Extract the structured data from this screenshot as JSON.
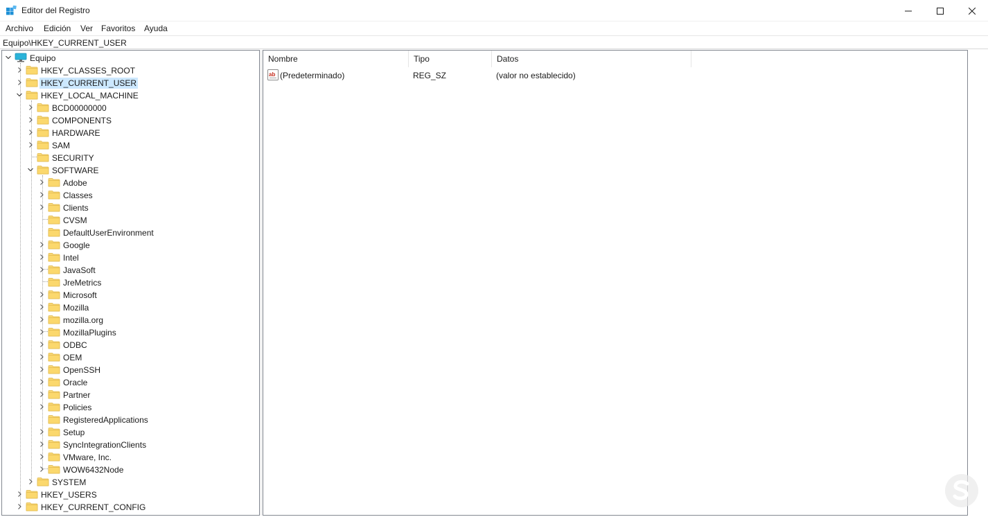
{
  "window": {
    "title": "Editor del Registro",
    "icon": "registry-editor-icon",
    "controls": [
      "minimize-icon",
      "maximize-icon",
      "close-icon"
    ]
  },
  "menu": [
    "Archivo",
    "Edición",
    "Ver",
    "Favoritos",
    "Ayuda"
  ],
  "address": "Equipo\\HKEY_CURRENT_USER",
  "tree": {
    "root": "Equipo",
    "nodes": [
      {
        "label": "HKEY_CLASSES_ROOT",
        "level": 1,
        "state": "collapsed"
      },
      {
        "label": "HKEY_CURRENT_USER",
        "level": 1,
        "state": "collapsed",
        "selected": true
      },
      {
        "label": "HKEY_LOCAL_MACHINE",
        "level": 1,
        "state": "expanded"
      },
      {
        "label": "BCD00000000",
        "level": 2,
        "state": "collapsed"
      },
      {
        "label": "COMPONENTS",
        "level": 2,
        "state": "collapsed"
      },
      {
        "label": "HARDWARE",
        "level": 2,
        "state": "collapsed"
      },
      {
        "label": "SAM",
        "level": 2,
        "state": "collapsed"
      },
      {
        "label": "SECURITY",
        "level": 2,
        "state": "leaf"
      },
      {
        "label": "SOFTWARE",
        "level": 2,
        "state": "expanded"
      },
      {
        "label": "Adobe",
        "level": 3,
        "state": "collapsed"
      },
      {
        "label": "Classes",
        "level": 3,
        "state": "collapsed"
      },
      {
        "label": "Clients",
        "level": 3,
        "state": "collapsed"
      },
      {
        "label": "CVSM",
        "level": 3,
        "state": "leaf"
      },
      {
        "label": "DefaultUserEnvironment",
        "level": 3,
        "state": "leaf"
      },
      {
        "label": "Google",
        "level": 3,
        "state": "collapsed"
      },
      {
        "label": "Intel",
        "level": 3,
        "state": "collapsed"
      },
      {
        "label": "JavaSoft",
        "level": 3,
        "state": "collapsed"
      },
      {
        "label": "JreMetrics",
        "level": 3,
        "state": "leaf"
      },
      {
        "label": "Microsoft",
        "level": 3,
        "state": "collapsed"
      },
      {
        "label": "Mozilla",
        "level": 3,
        "state": "collapsed"
      },
      {
        "label": "mozilla.org",
        "level": 3,
        "state": "collapsed"
      },
      {
        "label": "MozillaPlugins",
        "level": 3,
        "state": "collapsed"
      },
      {
        "label": "ODBC",
        "level": 3,
        "state": "collapsed"
      },
      {
        "label": "OEM",
        "level": 3,
        "state": "collapsed"
      },
      {
        "label": "OpenSSH",
        "level": 3,
        "state": "collapsed"
      },
      {
        "label": "Oracle",
        "level": 3,
        "state": "collapsed"
      },
      {
        "label": "Partner",
        "level": 3,
        "state": "collapsed"
      },
      {
        "label": "Policies",
        "level": 3,
        "state": "collapsed"
      },
      {
        "label": "RegisteredApplications",
        "level": 3,
        "state": "leaf"
      },
      {
        "label": "Setup",
        "level": 3,
        "state": "collapsed"
      },
      {
        "label": "SyncIntegrationClients",
        "level": 3,
        "state": "collapsed"
      },
      {
        "label": "VMware, Inc.",
        "level": 3,
        "state": "collapsed"
      },
      {
        "label": "WOW6432Node",
        "level": 3,
        "state": "collapsed"
      },
      {
        "label": "SYSTEM",
        "level": 2,
        "state": "collapsed"
      },
      {
        "label": "HKEY_USERS",
        "level": 1,
        "state": "collapsed"
      },
      {
        "label": "HKEY_CURRENT_CONFIG",
        "level": 1,
        "state": "collapsed"
      }
    ]
  },
  "list": {
    "columns": [
      "Nombre",
      "Tipo",
      "Datos"
    ],
    "rows": [
      {
        "icon": "string-value-icon",
        "name": "(Predeterminado)",
        "type": "REG_SZ",
        "data": "(valor no establecido)"
      }
    ]
  },
  "colors": {
    "selection": "#cce8ff",
    "folder": "#f8d775",
    "folder_edge": "#e0b84a",
    "pane_border": "#828790"
  },
  "watermark_icon": "solvetic-watermark-icon"
}
